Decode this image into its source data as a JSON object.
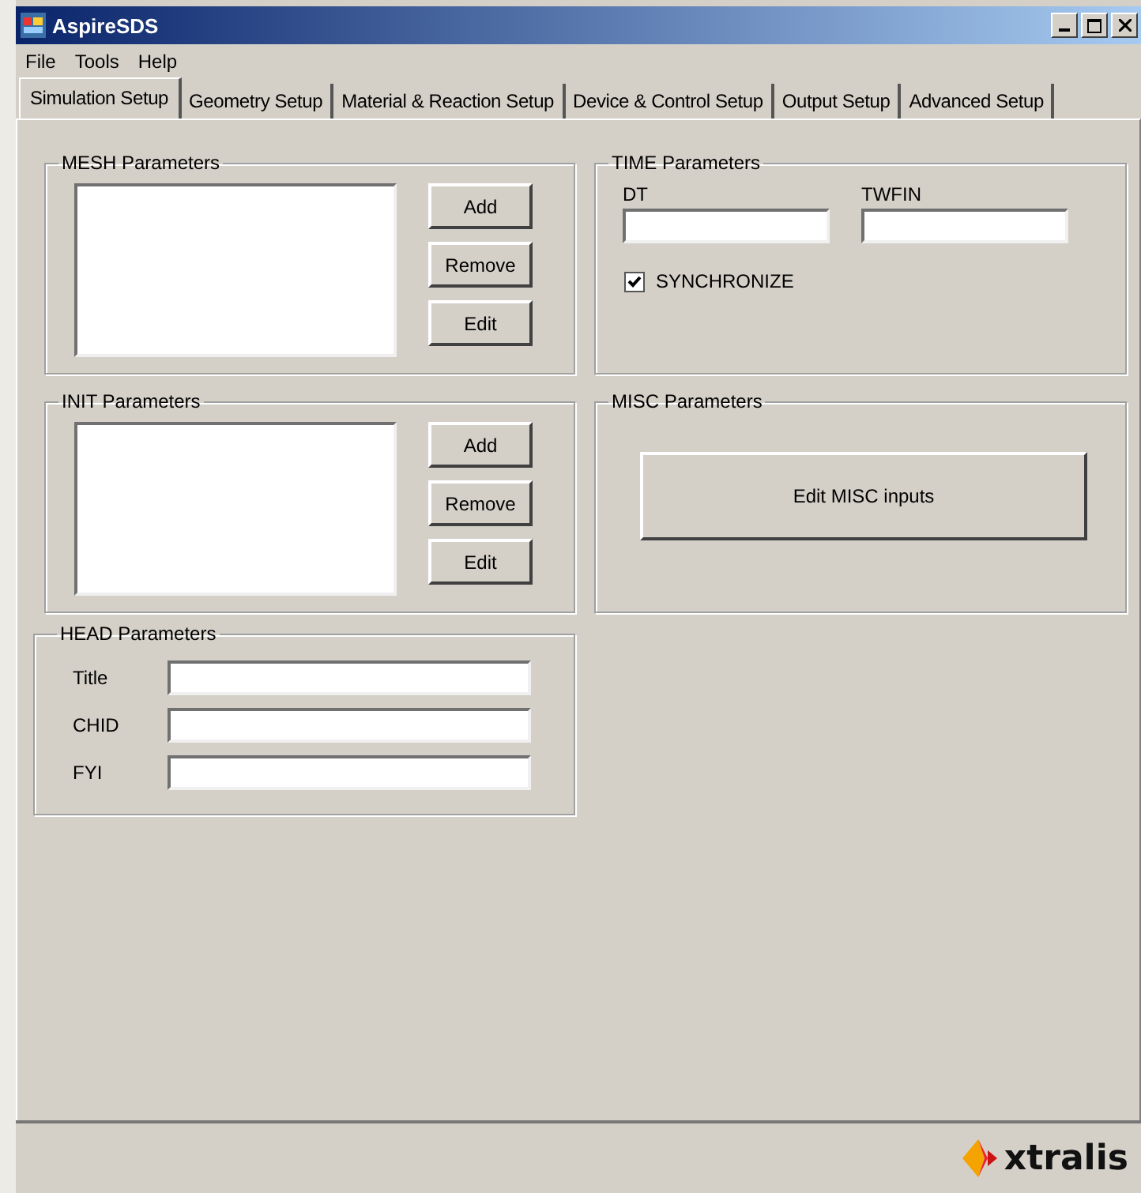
{
  "window": {
    "title": "AspireSDS"
  },
  "menu": [
    "File",
    "Tools",
    "Help"
  ],
  "tabs": [
    {
      "label": "Simulation Setup",
      "selected": true
    },
    {
      "label": "Geometry Setup",
      "selected": false
    },
    {
      "label": "Material & Reaction Setup",
      "selected": false
    },
    {
      "label": "Device & Control Setup",
      "selected": false
    },
    {
      "label": "Output Setup",
      "selected": false
    },
    {
      "label": "Advanced Setup",
      "selected": false
    }
  ],
  "mesh": {
    "title": "MESH Parameters",
    "buttons": [
      "Add",
      "Remove",
      "Edit"
    ]
  },
  "time": {
    "title": "TIME Parameters",
    "fields": [
      {
        "label": "DT"
      },
      {
        "label": "TWFIN"
      }
    ],
    "checkbox": {
      "label": "SYNCHRONIZE",
      "checked": true
    }
  },
  "init": {
    "title": "INIT Parameters",
    "buttons": [
      "Add",
      "Remove",
      "Edit"
    ]
  },
  "misc": {
    "title": "MISC Parameters",
    "button": "Edit MISC inputs"
  },
  "head": {
    "title": "HEAD Parameters",
    "fields": [
      {
        "label": "Title"
      },
      {
        "label": "CHID"
      },
      {
        "label": "FYI"
      }
    ]
  },
  "footer": {
    "logo": "xtralis"
  }
}
